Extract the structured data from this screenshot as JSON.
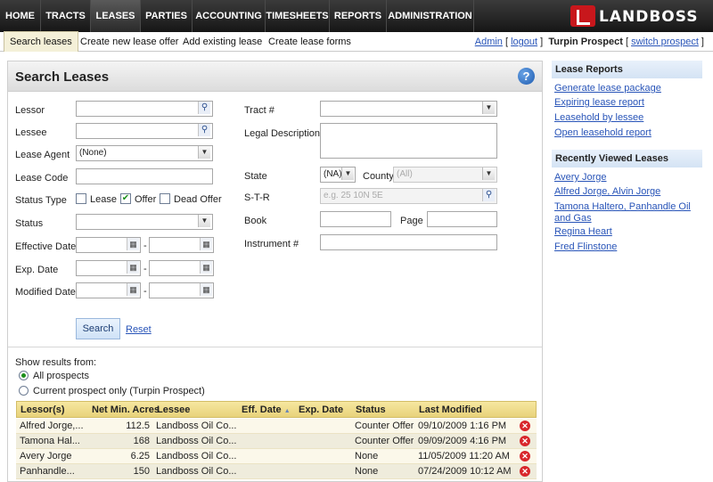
{
  "nav": {
    "items": [
      "HOME",
      "TRACTS",
      "LEASES",
      "PARTIES",
      "ACCOUNTING",
      "TIMESHEETS",
      "REPORTS",
      "ADMINISTRATION"
    ],
    "active": "LEASES",
    "logo_text": "LANDBOSS"
  },
  "subnav": {
    "items": [
      "Search leases",
      "Create new lease offer",
      "Add existing lease",
      "Create lease forms"
    ],
    "active": "Search leases",
    "user_link": "Admin",
    "logout_link": "logout",
    "prospect": "Turpin Prospect",
    "switch_link": "switch prospect"
  },
  "search": {
    "title": "Search Leases",
    "help_icon": "?",
    "labels": {
      "lessor": "Lessor",
      "lessee": "Lessee",
      "lease_agent": "Lease Agent",
      "lease_code": "Lease Code",
      "status_type": "Status Type",
      "status": "Status",
      "effective_date": "Effective Date",
      "exp_date": "Exp. Date",
      "modified_date": "Modified Date",
      "tract": "Tract #",
      "legal_description": "Legal Description",
      "state": "State",
      "county": "County",
      "str": "S-T-R",
      "book": "Book",
      "page": "Page",
      "instrument": "Instrument #"
    },
    "values": {
      "lessor": "",
      "lessee": "",
      "lease_agent": "(None)",
      "lease_code": "",
      "status": "",
      "tract": "",
      "legal_description": "",
      "state": "(NA)",
      "county": "(All)",
      "book": "",
      "page": "",
      "instrument": ""
    },
    "placeholders": {
      "str": "e.g. 25 10N 5E"
    },
    "status_types": [
      {
        "label": "Lease",
        "checked": false
      },
      {
        "label": "Offer",
        "checked": true
      },
      {
        "label": "Dead Offer",
        "checked": false
      }
    ],
    "date_separator": "-",
    "search_button": "Search",
    "reset_link": "Reset"
  },
  "results": {
    "show_from_label": "Show results from:",
    "options": [
      {
        "label": "All prospects",
        "selected": true
      },
      {
        "label": "Current prospect only (Turpin Prospect)",
        "selected": false
      }
    ],
    "columns": [
      "Lessor(s)",
      "Net Min. Acres",
      "Lessee",
      "Eff. Date",
      "Exp. Date",
      "Status",
      "Last Modified"
    ],
    "sort_indicator": "▲",
    "rows": [
      {
        "lessor": "Alfred Jorge,...",
        "acres": "112.5",
        "lessee": "Landboss Oil Co....",
        "eff": "",
        "exp": "",
        "status": "Counter Offer",
        "modified": "09/10/2009 1:16 PM"
      },
      {
        "lessor": "Tamona Hal...",
        "acres": "168",
        "lessee": "Landboss Oil Co....",
        "eff": "",
        "exp": "",
        "status": "Counter Offer",
        "modified": "09/09/2009 4:16 PM"
      },
      {
        "lessor": "Avery Jorge",
        "acres": "6.25",
        "lessee": "Landboss Oil Co....",
        "eff": "",
        "exp": "",
        "status": "None",
        "modified": "11/05/2009 11:20 AM"
      },
      {
        "lessor": "Panhandle...",
        "acres": "150",
        "lessee": "Landboss Oil Co....",
        "eff": "",
        "exp": "",
        "status": "None",
        "modified": "07/24/2009 10:12 AM"
      }
    ]
  },
  "sidebar": {
    "reports_title": "Lease Reports",
    "reports": [
      "Generate lease package",
      "Expiring lease report",
      "Leasehold by lessee",
      "Open leasehold report"
    ],
    "recent_title": "Recently Viewed Leases",
    "recent": [
      "Avery Jorge",
      "Alfred Jorge, Alvin Jorge",
      "Tamona Haltero, Panhandle Oil and Gas",
      "Regina Heart",
      "Fred Flinstone"
    ]
  },
  "colors": {
    "nav_bg": "#1e1e1e",
    "grid_header": "#f0dc8a",
    "link": "#2854b8",
    "delete": "#d8262b"
  }
}
